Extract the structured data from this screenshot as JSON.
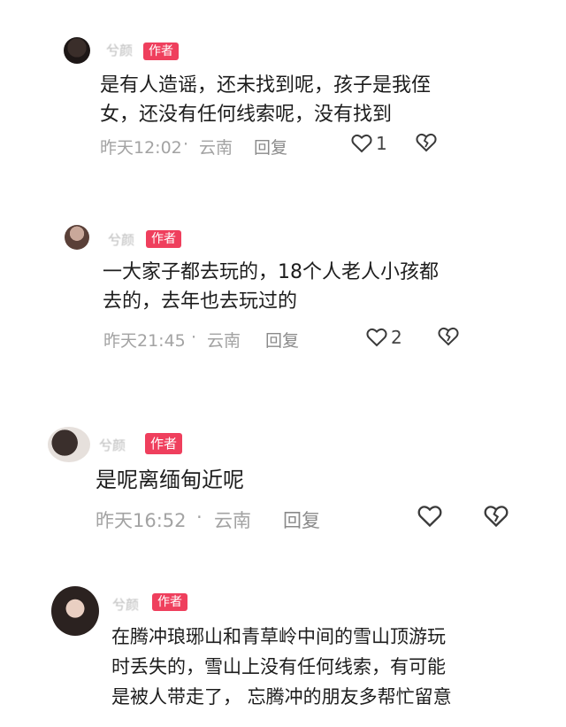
{
  "comments": [
    {
      "nickname": "兮颜",
      "badge": "作者",
      "lines": [
        "是有人造谣，还未找到呢，孩子是我侄",
        "女，还没有任何线索呢，没有找到"
      ],
      "time": "昨天12:02",
      "location": "云南",
      "separator": "·",
      "reply": "回复",
      "likes": "1",
      "like_icon": "heart-outline-icon",
      "dislike_icon": "broken-heart-icon"
    },
    {
      "nickname": "兮颜",
      "badge": "作者",
      "lines": [
        "一大家子都去玩的，18个人老人小孩都",
        "去的，去年也去玩过的"
      ],
      "time": "昨天21:45",
      "location": "云南",
      "separator": "·",
      "reply": "回复",
      "likes": "2",
      "like_icon": "heart-outline-icon",
      "dislike_icon": "broken-heart-icon"
    },
    {
      "nickname": "兮颜",
      "badge": "作者",
      "lines": [
        "是呢离缅甸近呢"
      ],
      "time": "昨天16:52",
      "location": "云南",
      "separator": "·",
      "reply": "回复",
      "likes": "",
      "like_icon": "heart-outline-icon",
      "dislike_icon": "broken-heart-icon"
    },
    {
      "nickname": "兮颜",
      "badge": "作者",
      "lines": [
        "在腾冲琅琊山和青草岭中间的雪山顶游玩",
        "时丢失的，雪山上没有任何线索，有可能",
        "是被人带走了，  忘腾冲的朋友多帮忙留意"
      ],
      "like_icon": "heart-outline-icon",
      "dislike_icon": "broken-heart-icon"
    }
  ]
}
